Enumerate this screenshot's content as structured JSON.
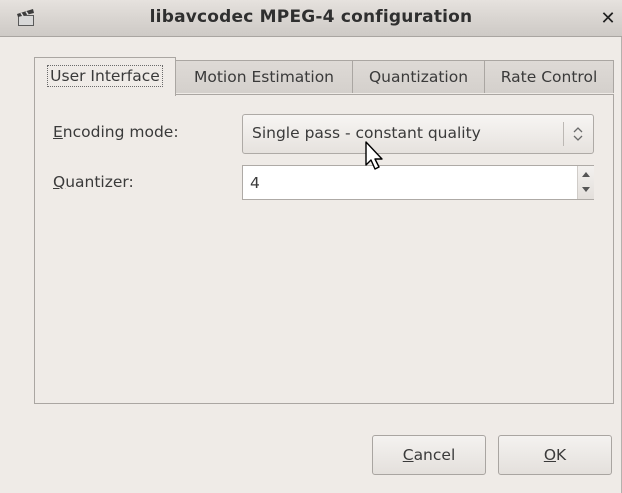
{
  "window": {
    "title": "libavcodec MPEG-4 configuration",
    "close_label": "✕"
  },
  "tabs": [
    {
      "label": "User Interface",
      "active": true
    },
    {
      "label": "Motion Estimation",
      "active": false
    },
    {
      "label": "Quantization",
      "active": false
    },
    {
      "label": "Rate Control",
      "active": false
    }
  ],
  "form": {
    "encoding_mode": {
      "label_mnemonic": "E",
      "label_rest": "ncoding mode:",
      "value": "Single pass - constant quality"
    },
    "quantizer": {
      "label_mnemonic": "Q",
      "label_rest": "uantizer:",
      "value": "4"
    }
  },
  "buttons": {
    "cancel": {
      "mnemonic": "C",
      "rest": "ancel"
    },
    "ok": {
      "mnemonic": "O",
      "rest": "K"
    }
  },
  "icons": {
    "app": "clapperboard-icon",
    "close": "close-icon",
    "combo_arrow": "updown-chevron-icon",
    "spin_up": "triangle-up-icon",
    "spin_down": "triangle-down-icon",
    "cursor": "mouse-pointer-icon"
  }
}
